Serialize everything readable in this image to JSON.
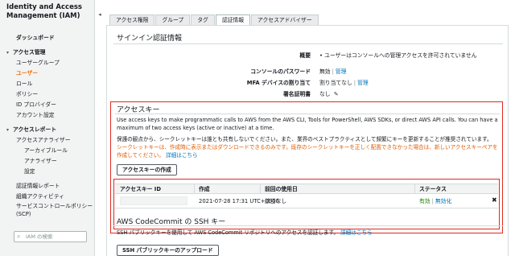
{
  "sidebar": {
    "title": "Identity and Access Management (IAM)",
    "dashboard": "ダッシュボード",
    "access_management": "アクセス管理",
    "user_groups": "ユーザーグループ",
    "users": "ユーザー",
    "roles": "ロール",
    "policies": "ポリシー",
    "id_providers": "ID プロバイダー",
    "account_settings": "アカウント設定",
    "access_reports": "アクセスレポート",
    "access_analyzer": "アクセスアナライザー",
    "archive_rules": "アーカイブルール",
    "analyzers": "アナライザー",
    "settings": "設定",
    "credential_report": "認証情報レポート",
    "org_activity": "組織アクティビティ",
    "scp": "サービスコントロールポリシー (SCP)",
    "search_placeholder": "IAM の検索"
  },
  "tabs": [
    "アクセス権限",
    "グループ",
    "タグ",
    "認証情報",
    "アクセスアドバイザー"
  ],
  "signin": {
    "heading": "サインイン認証情報",
    "summary_label": "概要",
    "summary_value": "• ユーザーはコンソールへの管理アクセスを許可されていません",
    "console_pw_label": "コンソールのパスワード",
    "console_pw_value": "無効",
    "console_pw_link": "管理",
    "mfa_label": "MFA デバイスの割り当て",
    "mfa_value": "割り当てなし",
    "mfa_link": "管理",
    "signing_cert_label": "署名証明書",
    "signing_cert_value": "なし"
  },
  "access_keys": {
    "heading": "アクセスキー",
    "description": "Use access keys to make programmatic calls to AWS from the AWS CLI, Tools for PowerShell, AWS SDKs, or direct AWS API calls. You can have a maximum of two access keys (active or inactive) at a time.",
    "security_note": "保護の観点から、シークレットキーは誰とも共有しないでください。また、業界のベストプラクティスとして頻繁にキーを更新することが推奨されています。",
    "warning": "シークレットキーは、作成時に表示またはダウンロードできるのみです。既存のシークレットキーを正しく配置できなかった場合は、新しいアクセスキーペアを作成してください。",
    "details_link": "詳細はこちら",
    "create_button": "アクセスキーの作成",
    "columns": [
      "アクセスキー ID",
      "作成",
      "前回の使用日",
      "ステータス"
    ],
    "rows": [
      {
        "created": "2021-07-28 17:31 UTC+0900",
        "last_used": "該当なし",
        "status": "有効",
        "action": "無効化"
      }
    ]
  },
  "codecommit": {
    "heading": "AWS CodeCommit の SSH キー",
    "description": "SSH パブリックキーを使用して AWS CodeCommit リポジトリへのアクセスを認証します。",
    "details_link": "詳細はこちら",
    "upload_button": "SSH パブリックキーのアップロード"
  }
}
